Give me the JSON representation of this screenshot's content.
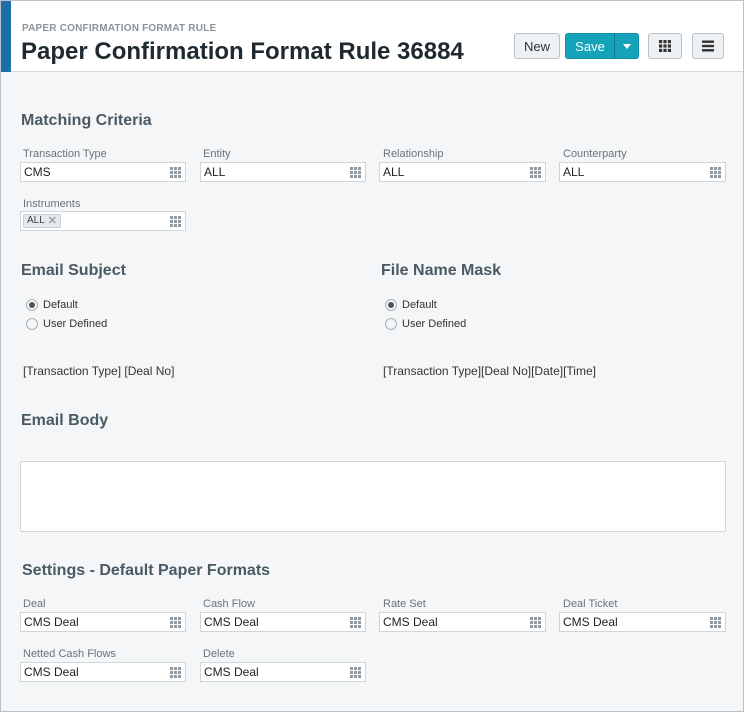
{
  "header": {
    "subtitle": "PAPER CONFIRMATION FORMAT RULE",
    "title": "Paper Confirmation Format Rule 36884",
    "new_label": "New",
    "save_label": "Save",
    "accent_color": "#1e6fa8",
    "save_color": "#14a3b8"
  },
  "matching": {
    "title": "Matching Criteria",
    "transaction_type": {
      "label": "Transaction Type",
      "value": "CMS"
    },
    "entity": {
      "label": "Entity",
      "value": "ALL"
    },
    "relationship": {
      "label": "Relationship",
      "value": "ALL"
    },
    "counterparty": {
      "label": "Counterparty",
      "value": "ALL"
    },
    "instruments": {
      "label": "Instruments",
      "tag": "ALL"
    }
  },
  "email_subject": {
    "title": "Email Subject",
    "options": [
      "Default",
      "User Defined"
    ],
    "selected": "Default",
    "mask": "[Transaction Type] [Deal No]"
  },
  "file_name_mask": {
    "title": "File Name Mask",
    "options": [
      "Default",
      "User Defined"
    ],
    "selected": "Default",
    "mask": "[Transaction Type][Deal No][Date][Time]"
  },
  "email_body": {
    "title": "Email Body",
    "value": ""
  },
  "settings": {
    "title": "Settings - Default Paper Formats",
    "deal": {
      "label": "Deal",
      "value": "CMS Deal"
    },
    "cash_flow": {
      "label": "Cash Flow",
      "value": "CMS Deal"
    },
    "rate_set": {
      "label": "Rate Set",
      "value": "CMS Deal"
    },
    "deal_ticket": {
      "label": "Deal Ticket",
      "value": "CMS Deal"
    },
    "netted_cash_flows": {
      "label": "Netted Cash Flows",
      "value": "CMS Deal"
    },
    "delete": {
      "label": "Delete",
      "value": "CMS Deal"
    }
  }
}
